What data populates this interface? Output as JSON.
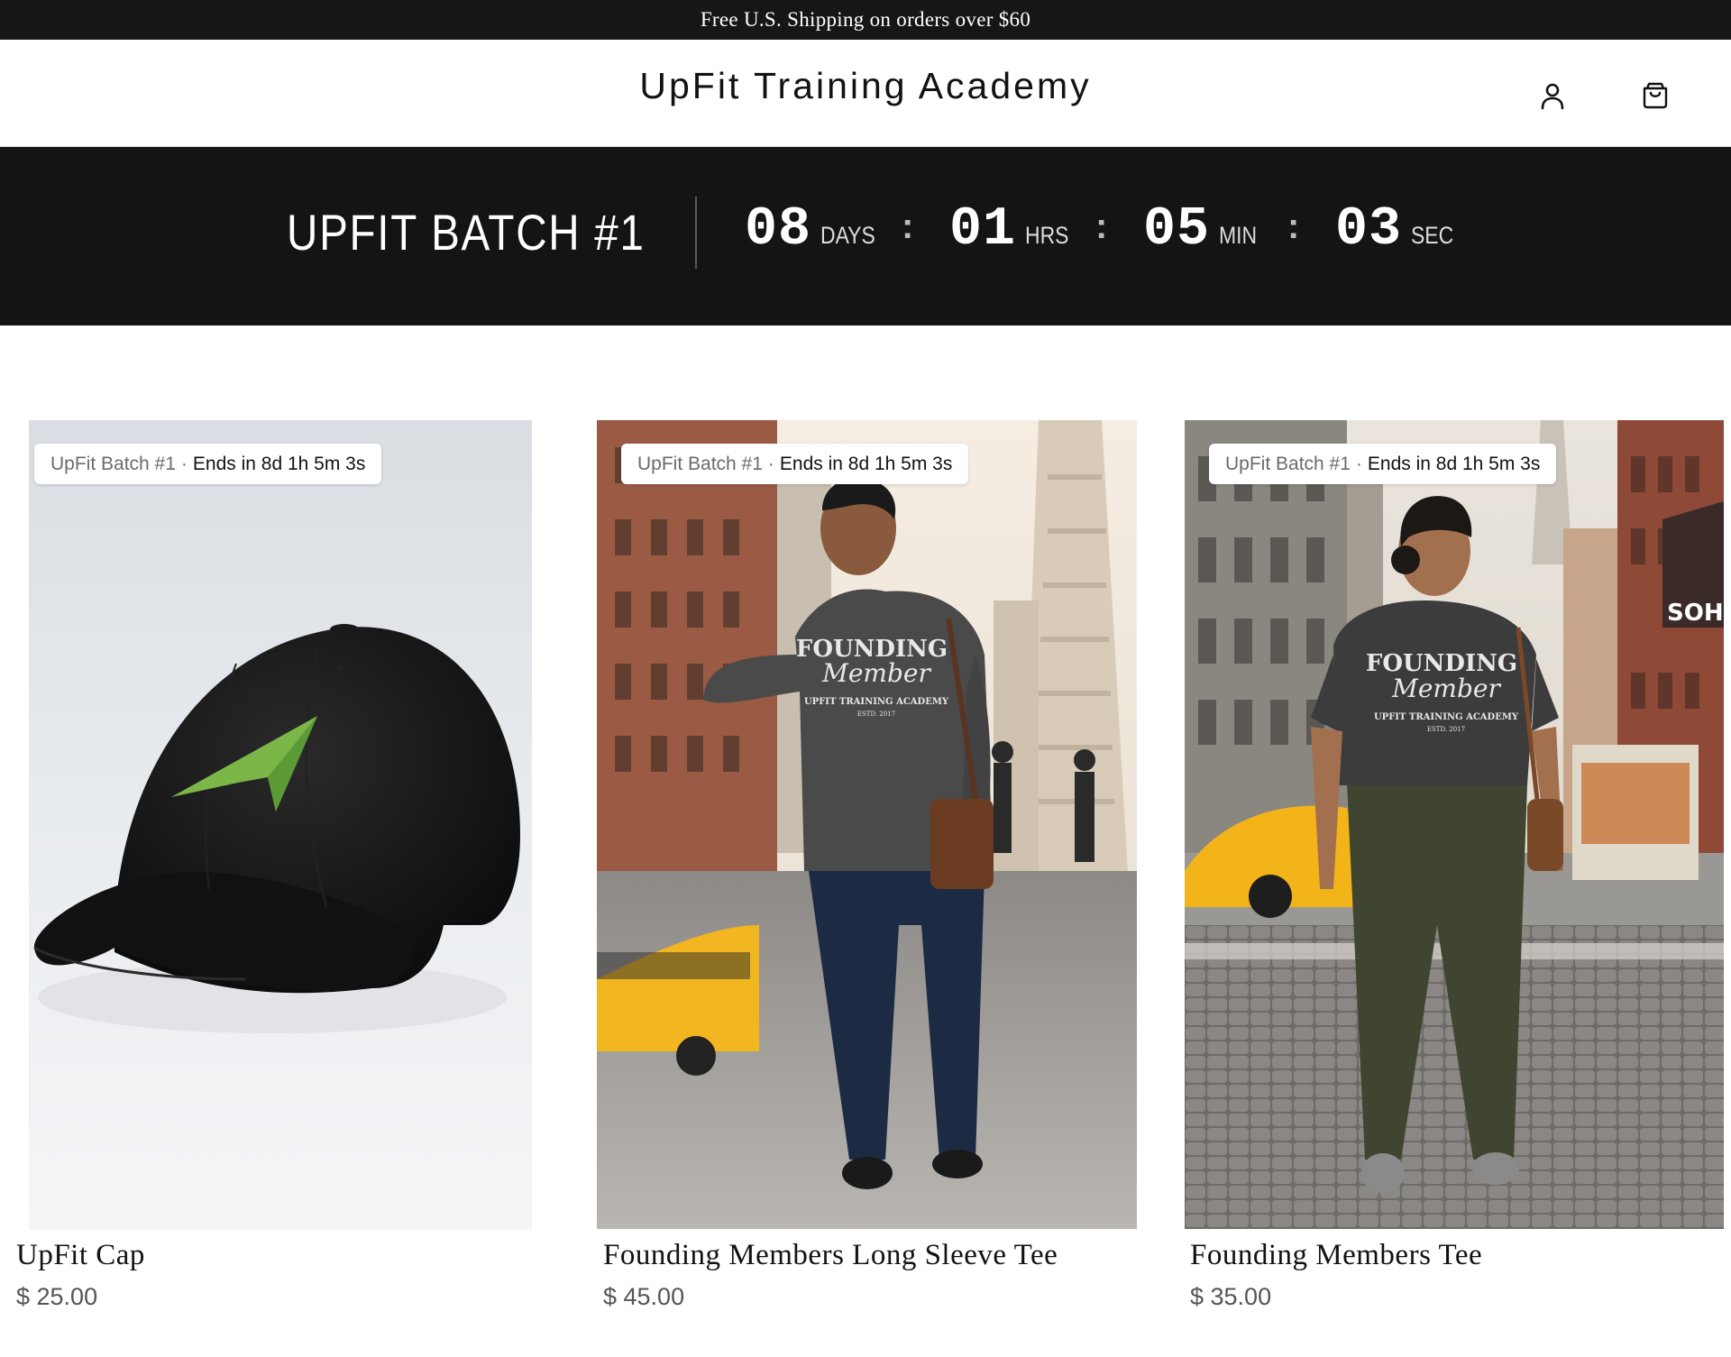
{
  "announcement": "Free U.S. Shipping on orders over $60",
  "header": {
    "logo": "UpFit Training Academy",
    "account_icon": "account-icon",
    "cart_icon": "cart-icon"
  },
  "countdown": {
    "title": "UPFIT BATCH #1",
    "days": "08",
    "days_label": "DAYS",
    "hours": "01",
    "hours_label": "HRS",
    "minutes": "05",
    "minutes_label": "MIN",
    "seconds": "03",
    "seconds_label": "SEC",
    "separator": ":"
  },
  "products": [
    {
      "badge_name": "UpFit Batch #1",
      "badge_sep": "·",
      "badge_ends": "Ends in 8d 1h 5m 3s",
      "title": "UpFit Cap",
      "price": "$ 25.00"
    },
    {
      "badge_name": "UpFit Batch #1",
      "badge_sep": "·",
      "badge_ends": "Ends in 8d 1h 5m 3s",
      "title": "Founding Members Long Sleeve Tee",
      "price": "$ 45.00",
      "shirt_text": [
        "FOUNDING",
        "Member",
        "UPFIT TRAINING ACADEMY",
        "ESTD. 2017"
      ]
    },
    {
      "badge_name": "UpFit Batch #1",
      "badge_sep": "·",
      "badge_ends": "Ends in 8d 1h 5m 3s",
      "title": "Founding Members Tee",
      "price": "$ 35.00",
      "shirt_text": [
        "FOUNDING",
        "Member",
        "UPFIT TRAINING ACADEMY",
        "ESTD. 2017"
      ],
      "street_sign": "SOHO"
    }
  ]
}
